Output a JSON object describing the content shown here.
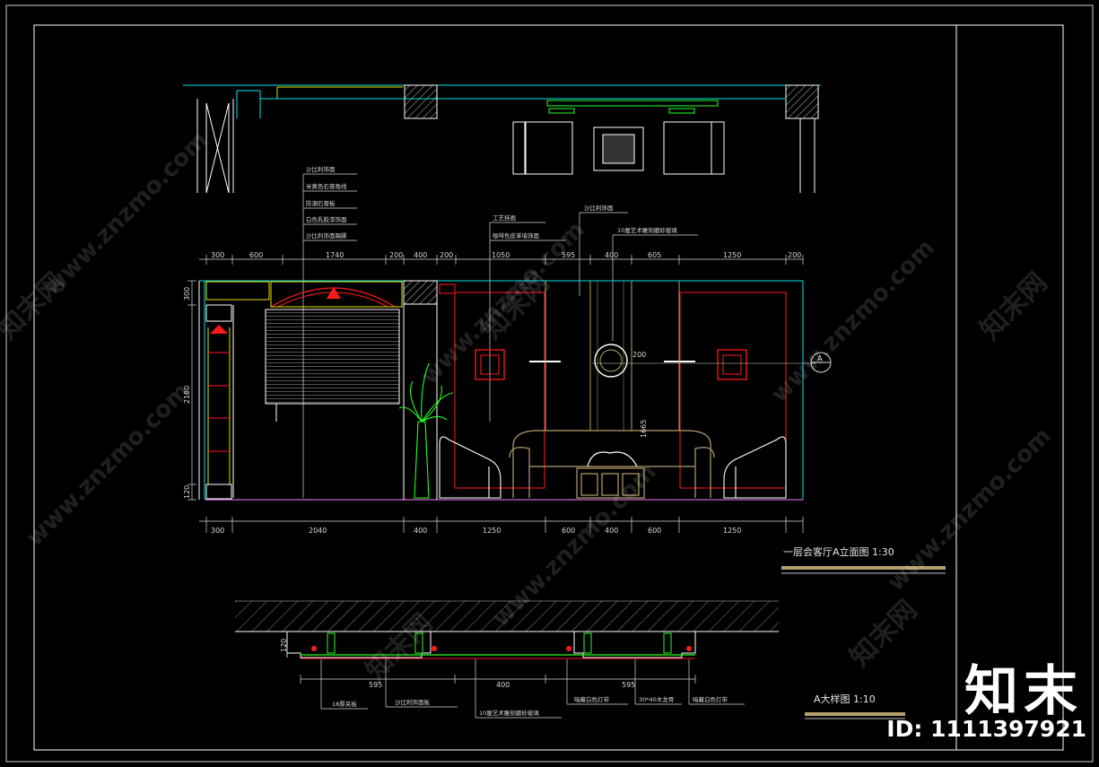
{
  "titles": {
    "elevation": "一层会客厅A立面图 1:30",
    "detail": "A大样图 1:10"
  },
  "colors": {
    "background": "#000000",
    "frame": "#ffffff",
    "cyan": "#00e5e5",
    "yellow": "#e8e000",
    "red": "#ff1a1a",
    "green": "#22ff22",
    "magenta": "#ff00ff",
    "tan": "#b4a06e",
    "text": "#d8d8d8"
  },
  "annotations_left": [
    "沙比利饰面",
    "米黄色石膏角线",
    "防潮石膏板",
    "白色乳胶漆饰面",
    "沙比利饰面踢脚"
  ],
  "annotations_center": [
    "工艺挂画",
    "咖啡色皮革墙饰面"
  ],
  "annotations_right": [
    "沙比利饰面",
    "10厘艺术雕刻磨砂玻璃"
  ],
  "dims_top": [
    "300",
    "600",
    "1740",
    "200",
    "400",
    "200",
    "1050",
    "595",
    "400",
    "605",
    "1250",
    "200"
  ],
  "dims_bottom": [
    "300",
    "2040",
    "400",
    "1250",
    "600",
    "400",
    "600",
    "1250"
  ],
  "dims_left": [
    "300",
    "2180",
    "120"
  ],
  "dims_misc": {
    "center_width": "200",
    "center_height": "1665"
  },
  "section_marker": "A",
  "detail_dims": [
    "595",
    "400",
    "595",
    "120"
  ],
  "detail_labels": [
    "18厚夹板",
    "沙比利饰面板",
    "10厘艺术雕刻磨砂玻璃",
    "暗藏白色灯带",
    "30*40木龙骨",
    "暗藏白色灯带"
  ],
  "watermark": {
    "brand": "知末",
    "id": "ID: 1111397921",
    "site": "www.znzmo.com",
    "site_cn": "知末网"
  }
}
